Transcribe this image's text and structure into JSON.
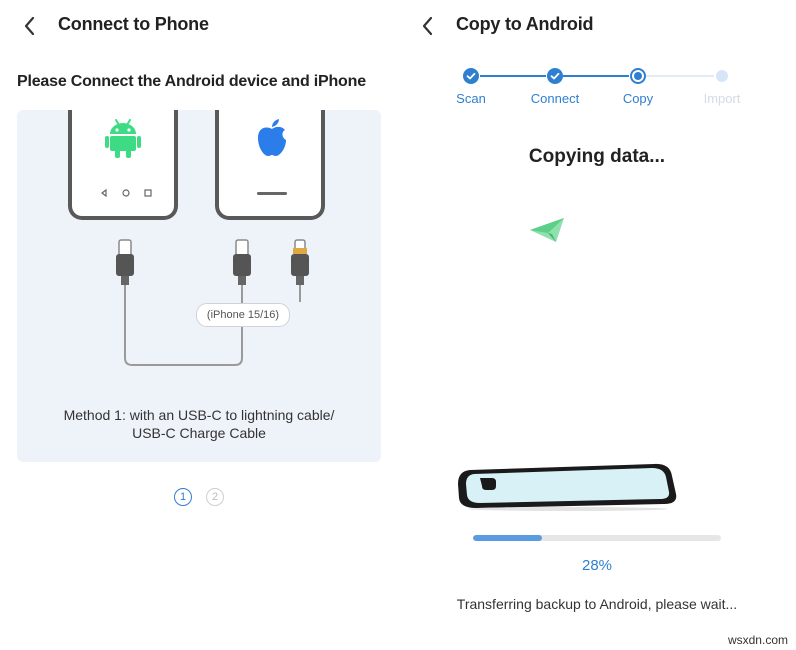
{
  "left": {
    "title": "Connect to Phone",
    "subtitle": "Please Connect the Android device and iPhone",
    "cable_tag": "(iPhone 15/16)",
    "method_line1": "Method 1: with an USB-C to lightning cable/",
    "method_line2": "USB-C Charge Cable",
    "pager": [
      "1",
      "2"
    ]
  },
  "right": {
    "title": "Copy to Android",
    "steps": [
      {
        "label": "Scan",
        "state": "done"
      },
      {
        "label": "Connect",
        "state": "done"
      },
      {
        "label": "Copy",
        "state": "active"
      },
      {
        "label": "Import",
        "state": "pending"
      }
    ],
    "heading": "Copying data...",
    "progress": {
      "value": 28,
      "label": "28%"
    },
    "status": "Transferring backup to Android, please wait..."
  },
  "colors": {
    "accent": "#2f7fd1",
    "android_green": "#3ddc84",
    "apple_blue": "#2b7de9",
    "plane_green": "#66d28f",
    "card_bg": "#eef2f9"
  },
  "watermark": "wsxdn.com"
}
